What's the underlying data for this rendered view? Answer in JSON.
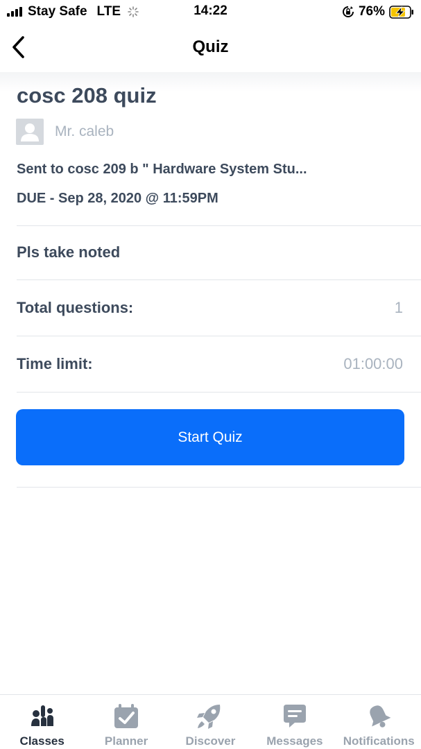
{
  "status_bar": {
    "carrier": "Stay Safe",
    "network": "LTE",
    "time": "14:22",
    "battery_percent": "76%"
  },
  "nav": {
    "title": "Quiz",
    "back_icon": "chevron-left-icon"
  },
  "quiz": {
    "title": "cosc 208 quiz",
    "teacher": "Mr. caleb",
    "sent_prefix": "Sent to",
    "sent_to": "cosc 209 b \" Hardware System Stu...",
    "due": "DUE - Sep 28, 2020 @ 11:59PM",
    "description": "Pls take noted",
    "total_questions_label": "Total questions:",
    "total_questions_value": "1",
    "time_limit_label": "Time limit:",
    "time_limit_value": "01:00:00",
    "start_label": "Start Quiz"
  },
  "tabs": [
    {
      "label": "Classes",
      "icon": "classes-icon",
      "active": true
    },
    {
      "label": "Planner",
      "icon": "planner-icon",
      "active": false
    },
    {
      "label": "Discover",
      "icon": "rocket-icon",
      "active": false
    },
    {
      "label": "Messages",
      "icon": "chat-bubble-icon",
      "active": false
    },
    {
      "label": "Notifications",
      "icon": "bell-icon",
      "active": false
    }
  ],
  "colors": {
    "primary": "#0a6efa",
    "text_dark": "#3d4a5c",
    "text_muted": "#a9b3bf",
    "tab_inactive": "#9aa3ae",
    "tab_active": "#27313f"
  }
}
